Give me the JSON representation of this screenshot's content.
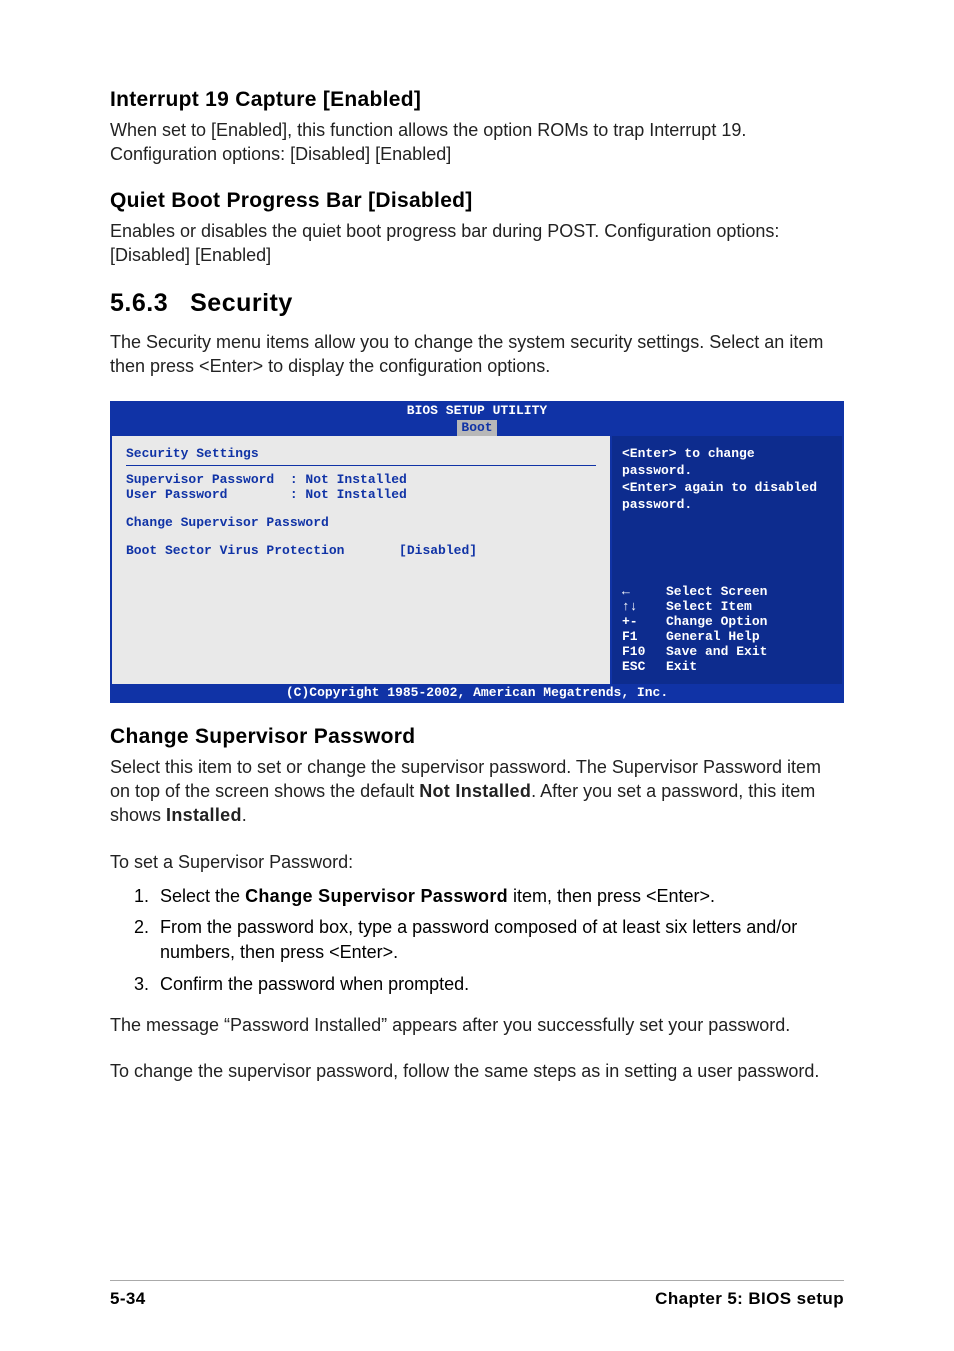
{
  "sections": {
    "interrupt": {
      "heading": "Interrupt 19 Capture [Enabled]",
      "body": "When set to [Enabled], this function allows the option ROMs to trap Interrupt 19. Configuration options: [Disabled] [Enabled]"
    },
    "quietboot": {
      "heading": "Quiet Boot Progress Bar [Disabled]",
      "body": "Enables or disables the quiet boot progress bar during POST. Configuration options: [Disabled] [Enabled]"
    },
    "security": {
      "num": "5.6.3",
      "title": "Security",
      "intro": "The Security menu items allow you to change the system security settings. Select an item then press <Enter> to display the configuration options."
    },
    "changesup": {
      "heading": "Change Supervisor Password",
      "p1_a": "Select this item to set or change the supervisor password. The Supervisor Password item on top of the screen shows the default ",
      "p1_b": "Not Installed",
      "p1_c": ". After you set a password, this item shows ",
      "p1_d": "Installed",
      "p1_e": ".",
      "p2": "To set a Supervisor Password:",
      "steps": {
        "s1a": "Select the ",
        "s1b": "Change Supervisor Password",
        "s1c": " item, then press <Enter>.",
        "s2": "From the password box, type a password composed of at least six letters and/or numbers, then press <Enter>.",
        "s3": "Confirm the password when prompted."
      },
      "p3": "The message “Password Installed” appears after you successfully set your password.",
      "p4": "To change the supervisor password, follow the same steps as in setting a user password."
    }
  },
  "bios": {
    "title": "BIOS SETUP UTILITY",
    "tab": "Boot",
    "left": {
      "heading": "Security Settings",
      "rows": {
        "sup": "Supervisor Password  : Not Installed",
        "user": "User Password        : Not Installed",
        "chg": "Change Supervisor Password",
        "bsvp": "Boot Sector Virus Protection       [Disabled]"
      }
    },
    "right": {
      "help": "<Enter> to change password.\n<Enter> again to disabled password.",
      "keys": [
        {
          "glyph": "←",
          "label": "Select Screen"
        },
        {
          "glyph": "↑↓",
          "label": "Select Item"
        },
        {
          "glyph": "+-",
          "label": "Change Option"
        },
        {
          "glyph": "F1",
          "label": "General Help"
        },
        {
          "glyph": "F10",
          "label": "Save and Exit"
        },
        {
          "glyph": "ESC",
          "label": "Exit"
        }
      ]
    },
    "footer": "(C)Copyright 1985-2002, American Megatrends, Inc."
  },
  "footer": {
    "page": "5-34",
    "chapter": "Chapter 5: BIOS setup"
  }
}
